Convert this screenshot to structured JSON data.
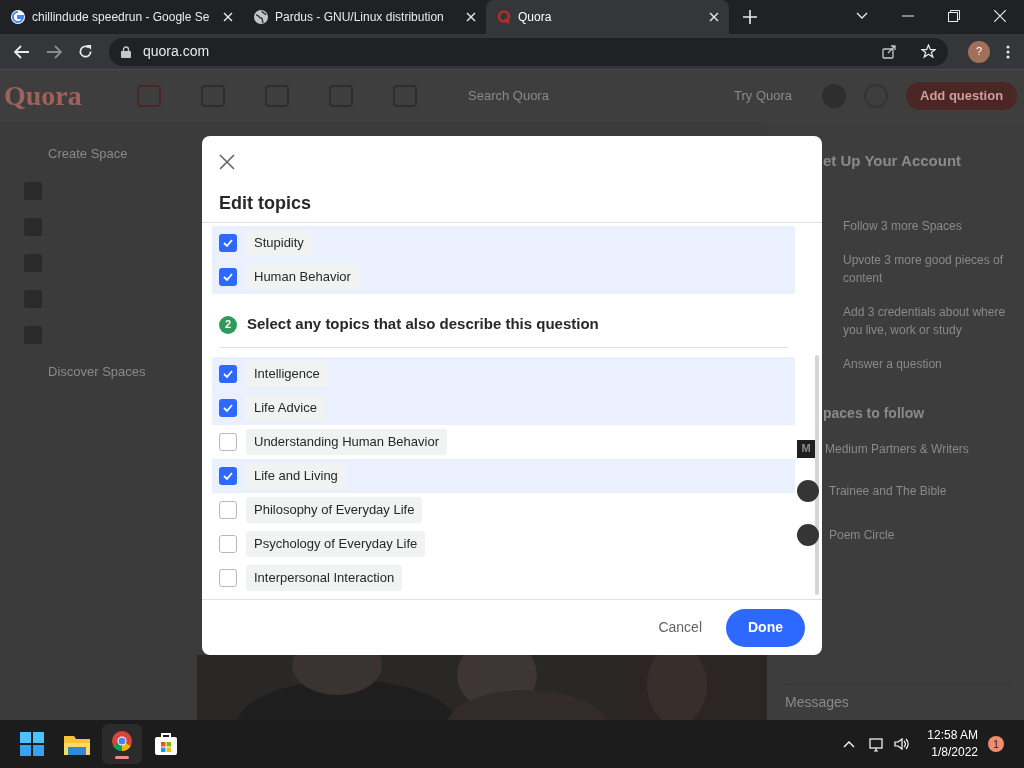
{
  "browser": {
    "tabs": [
      {
        "title": "chillindude speedrun - Google Se",
        "selected": false
      },
      {
        "title": "Pardus - GNU/Linux distribution",
        "selected": false
      },
      {
        "title": "Quora",
        "selected": true
      }
    ],
    "url": "quora.com",
    "profile": "?"
  },
  "site_header": {
    "logo": "Quora",
    "search_placeholder": "Search Quora",
    "try_link": "Try Quora",
    "add_button": "Add question"
  },
  "sidebar": {
    "items": [
      {
        "label": "Create Space",
        "kind": "action"
      },
      {
        "kind": "space"
      },
      {
        "kind": "space"
      },
      {
        "kind": "space"
      },
      {
        "kind": "space"
      },
      {
        "kind": "space"
      },
      {
        "label": "Discover Spaces",
        "kind": "action"
      }
    ]
  },
  "right_panel": {
    "title": "et Up Your Account",
    "tasks": [
      "Follow 3 more Spaces",
      "Upvote 3 more good pieces of content",
      "Add 3 credentials about where you live, work or study",
      "Answer a question"
    ],
    "spaces_title": "paces to follow",
    "spaces": [
      {
        "name": "Medium Partners & Writers",
        "badge": "M"
      },
      {
        "name": "Trainee and The Bible"
      },
      {
        "name": "Poem Circle"
      }
    ],
    "messages": "Messages"
  },
  "dialog": {
    "title": "Edit topics",
    "top_topics": [
      {
        "label": "Stupidity",
        "checked": true
      },
      {
        "label": "Human Behavior",
        "checked": true
      }
    ],
    "step": "2",
    "step_title": "Select any topics that also describe this question",
    "topics": [
      {
        "label": "Intelligence",
        "checked": true
      },
      {
        "label": "Life Advice",
        "checked": true
      },
      {
        "label": "Understanding Human Behavior",
        "checked": false
      },
      {
        "label": "Life and Living",
        "checked": true
      },
      {
        "label": "Philosophy of Everyday Life",
        "checked": false
      },
      {
        "label": "Psychology of Everyday Life",
        "checked": false
      },
      {
        "label": "Interpersonal Interaction",
        "checked": false
      }
    ],
    "cancel": "Cancel",
    "done": "Done"
  },
  "taskbar": {
    "time": "12:58 AM",
    "date": "1/8/2022",
    "notifications": "1"
  }
}
